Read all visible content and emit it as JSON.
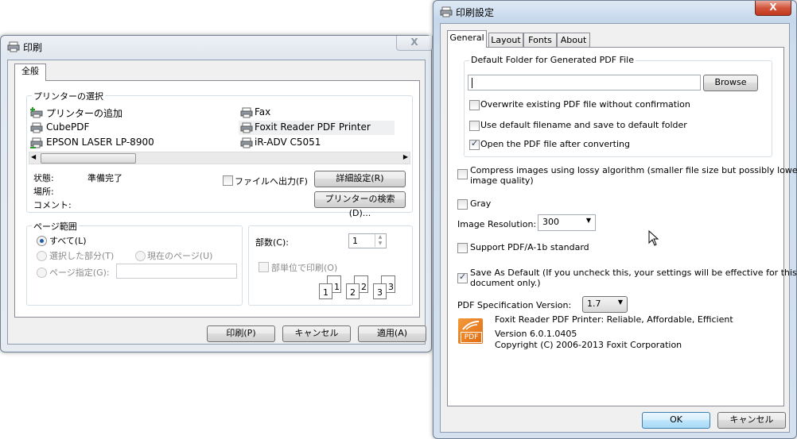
{
  "print_dialog": {
    "title": "印刷",
    "tab": "全般",
    "printer_group_label": "プリンターの選択",
    "printers": [
      {
        "name": "プリンターの追加",
        "icon": "add-printer-icon"
      },
      {
        "name": "Fax",
        "icon": "fax-printer-icon"
      },
      {
        "name": "CubePDF",
        "icon": "printer-icon"
      },
      {
        "name": "Foxit Reader PDF Printer",
        "icon": "printer-icon"
      },
      {
        "name": "EPSON LASER LP-8900",
        "icon": "network-printer-icon"
      },
      {
        "name": "iR-ADV C5051",
        "icon": "printer-icon"
      }
    ],
    "status_label": "状態:",
    "status_value": "準備完了",
    "location_label": "場所:",
    "comment_label": "コメント:",
    "print_to_file_label": "ファイルへ出力(F)",
    "preferences_button": "詳細設定(R)",
    "find_printer_button": "プリンターの検索(D)...",
    "page_range_label": "ページ範囲",
    "all_label": "すべて(L)",
    "selection_label": "選択した部分(T)",
    "current_page_label": "現在のページ(U)",
    "pages_label": "ページ指定(G):",
    "copies_label": "部数(C):",
    "copies_value": "1",
    "collate_label": "部単位で印刷(O)",
    "collate_numbers": [
      "1",
      "1",
      "2",
      "2",
      "3",
      "3"
    ],
    "print_button": "印刷(P)",
    "cancel_button": "キャンセル",
    "apply_button": "適用(A)"
  },
  "settings_dialog": {
    "title": "印刷設定",
    "tabs": [
      "General",
      "Layout",
      "Fonts",
      "About"
    ],
    "folder_group_label": "Default Folder for Generated PDF File",
    "folder_value": "",
    "browse_button": "Browse",
    "overwrite_label": "Overwrite existing PDF file without confirmation",
    "default_filename_label": "Use default filename and save to default folder",
    "open_pdf_label": "Open the PDF file after converting",
    "compress_label_1": "Compress images using lossy algorithm (smaller file size but possibly lower",
    "compress_label_2": "image quality)",
    "gray_label": "Gray",
    "resolution_label": "Image Resolution:",
    "resolution_value": "300",
    "pdfa_label": "Support PDF/A-1b standard",
    "save_default_label_1": "Save As Default (If you uncheck this, your settings will be effective for this",
    "save_default_label_2": "document only.)",
    "spec_label": "PDF Specification Version:",
    "spec_value": "1.7",
    "logo_text": "PDF",
    "product_line": "Foxit Reader PDF Printer: Reliable, Affordable, Efficient",
    "version_line": "Version 6.0.1.0405",
    "copyright_line": "Copyright (C) 2006-2013 Foxit Corporation",
    "ok_button": "OK",
    "cancel_button": "キャンセル",
    "close_glyph": "X"
  },
  "colors": {
    "accent": "#3c7fb1",
    "logo_orange": "#e8741c",
    "close_red": "#c7432a"
  }
}
